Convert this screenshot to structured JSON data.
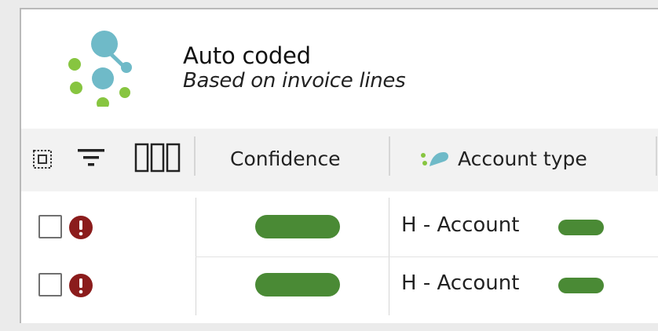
{
  "header": {
    "title": "Auto coded",
    "subtitle": "Based on invoice lines",
    "logo_icon": "auto-code-molecule-icon"
  },
  "toolbar": {
    "icons": [
      "select-all-icon",
      "filter-icon",
      "columns-icon"
    ]
  },
  "columns": [
    {
      "label": "Confidence"
    },
    {
      "label": "Account type",
      "icon": "auto-code-mini-icon"
    }
  ],
  "rows": [
    {
      "account": "H - Account",
      "status_icon": "error-icon",
      "confidence": "high",
      "account_confidence": "high"
    },
    {
      "account": "H - Account",
      "status_icon": "error-icon",
      "confidence": "high",
      "account_confidence": "high"
    }
  ],
  "colors": {
    "confidence_high": "#4a8a35",
    "error": "#8b1c1c",
    "logo_teal": "#6fbac8",
    "logo_green": "#87c540"
  }
}
